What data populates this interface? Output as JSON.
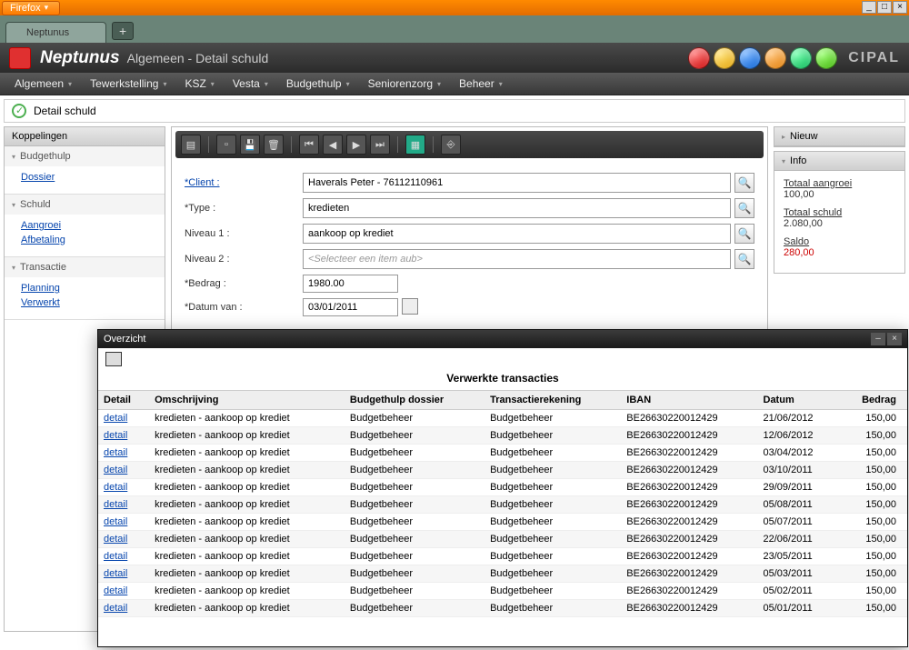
{
  "browser": {
    "name": "Firefox",
    "tab": "Neptunus"
  },
  "window_controls": {
    "min": "_",
    "max": "□",
    "close": "×"
  },
  "app": {
    "title": "Neptunus",
    "section": "Algemeen",
    "page": "Detail schuld",
    "brand": "CIPAL"
  },
  "menu": [
    "Algemeen",
    "Tewerkstelling",
    "KSZ",
    "Vesta",
    "Budgethulp",
    "Seniorenzorg",
    "Beheer"
  ],
  "page_title": "Detail schuld",
  "sidebar": {
    "header": "Koppelingen",
    "sections": [
      {
        "title": "Budgethulp",
        "links": [
          "Dossier"
        ]
      },
      {
        "title": "Schuld",
        "links": [
          "Aangroei",
          "Afbetaling"
        ]
      },
      {
        "title": "Transactie",
        "links": [
          "Planning",
          "Verwerkt"
        ]
      }
    ]
  },
  "form": {
    "client_label": "*Client :",
    "client_value": "Haverals Peter - 76112110961",
    "type_label": "*Type :",
    "type_value": "kredieten",
    "niveau1_label": "Niveau 1 :",
    "niveau1_value": "aankoop op krediet",
    "niveau2_label": "Niveau 2 :",
    "niveau2_placeholder": "<Selecteer een item aub>",
    "bedrag_label": "*Bedrag :",
    "bedrag_value": "1980.00",
    "datum_label": "*Datum van :",
    "datum_value": "03/01/2011"
  },
  "right": {
    "nieuw": "Nieuw",
    "info": "Info",
    "aangroei_label": "Totaal aangroei",
    "aangroei_value": "100,00",
    "schuld_label": "Totaal schuld",
    "schuld_value": "2.080,00",
    "saldo_label": "Saldo",
    "saldo_value": "280,00"
  },
  "overlay": {
    "title": "Overzicht",
    "heading": "Verwerkte transacties",
    "columns": [
      "Detail",
      "Omschrijving",
      "Budgethulp dossier",
      "Transactierekening",
      "IBAN",
      "Datum",
      "Bedrag"
    ],
    "detail_link": "detail",
    "rows": [
      {
        "omschrijving": "kredieten - aankoop op krediet",
        "dossier": "Budgetbeheer",
        "rekening": "Budgetbeheer",
        "iban": "BE26630220012429",
        "datum": "21/06/2012",
        "bedrag": "150,00"
      },
      {
        "omschrijving": "kredieten - aankoop op krediet",
        "dossier": "Budgetbeheer",
        "rekening": "Budgetbeheer",
        "iban": "BE26630220012429",
        "datum": "12/06/2012",
        "bedrag": "150,00"
      },
      {
        "omschrijving": "kredieten - aankoop op krediet",
        "dossier": "Budgetbeheer",
        "rekening": "Budgetbeheer",
        "iban": "BE26630220012429",
        "datum": "03/04/2012",
        "bedrag": "150,00"
      },
      {
        "omschrijving": "kredieten - aankoop op krediet",
        "dossier": "Budgetbeheer",
        "rekening": "Budgetbeheer",
        "iban": "BE26630220012429",
        "datum": "03/10/2011",
        "bedrag": "150,00"
      },
      {
        "omschrijving": "kredieten - aankoop op krediet",
        "dossier": "Budgetbeheer",
        "rekening": "Budgetbeheer",
        "iban": "BE26630220012429",
        "datum": "29/09/2011",
        "bedrag": "150,00"
      },
      {
        "omschrijving": "kredieten - aankoop op krediet",
        "dossier": "Budgetbeheer",
        "rekening": "Budgetbeheer",
        "iban": "BE26630220012429",
        "datum": "05/08/2011",
        "bedrag": "150,00"
      },
      {
        "omschrijving": "kredieten - aankoop op krediet",
        "dossier": "Budgetbeheer",
        "rekening": "Budgetbeheer",
        "iban": "BE26630220012429",
        "datum": "05/07/2011",
        "bedrag": "150,00"
      },
      {
        "omschrijving": "kredieten - aankoop op krediet",
        "dossier": "Budgetbeheer",
        "rekening": "Budgetbeheer",
        "iban": "BE26630220012429",
        "datum": "22/06/2011",
        "bedrag": "150,00"
      },
      {
        "omschrijving": "kredieten - aankoop op krediet",
        "dossier": "Budgetbeheer",
        "rekening": "Budgetbeheer",
        "iban": "BE26630220012429",
        "datum": "23/05/2011",
        "bedrag": "150,00"
      },
      {
        "omschrijving": "kredieten - aankoop op krediet",
        "dossier": "Budgetbeheer",
        "rekening": "Budgetbeheer",
        "iban": "BE26630220012429",
        "datum": "05/03/2011",
        "bedrag": "150,00"
      },
      {
        "omschrijving": "kredieten - aankoop op krediet",
        "dossier": "Budgetbeheer",
        "rekening": "Budgetbeheer",
        "iban": "BE26630220012429",
        "datum": "05/02/2011",
        "bedrag": "150,00"
      },
      {
        "omschrijving": "kredieten - aankoop op krediet",
        "dossier": "Budgetbeheer",
        "rekening": "Budgetbeheer",
        "iban": "BE26630220012429",
        "datum": "05/01/2011",
        "bedrag": "150,00"
      }
    ]
  }
}
